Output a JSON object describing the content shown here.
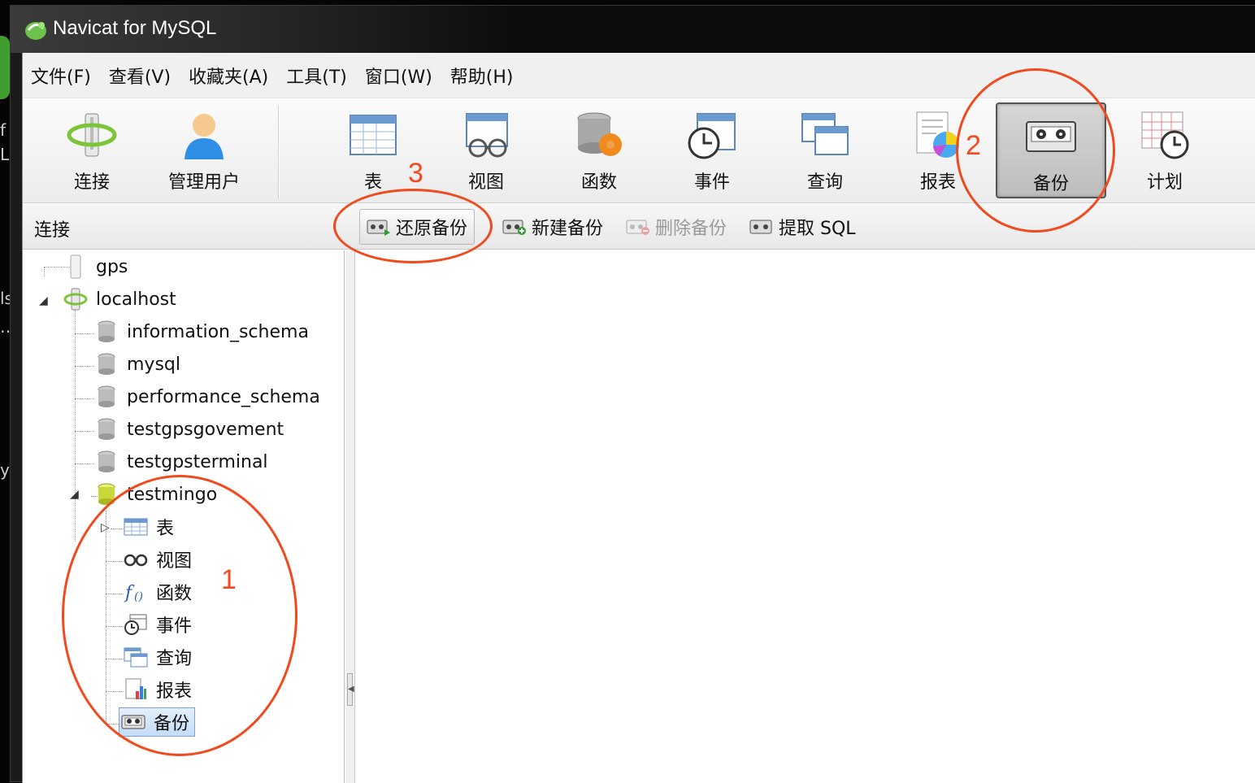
{
  "window": {
    "title": "Navicat for MySQL"
  },
  "desktop": {
    "sliver_texts": [
      "f",
      "L",
      "ls",
      "…",
      "yp"
    ]
  },
  "menu": [
    "文件(F)",
    "查看(V)",
    "收藏夹(A)",
    "工具(T)",
    "窗口(W)",
    "帮助(H)"
  ],
  "toolbar": {
    "connect": "连接",
    "manage_users": "管理用户",
    "table": "表",
    "view": "视图",
    "function": "函数",
    "event": "事件",
    "query": "查询",
    "report": "报表",
    "backup": "备份",
    "schedule": "计划"
  },
  "panel_header": {
    "connection": "连接"
  },
  "object_toolbar": {
    "restore": "还原备份",
    "new": "新建备份",
    "delete": "删除备份",
    "extract": "提取 SQL"
  },
  "tree": {
    "gps": "gps",
    "localhost": "localhost",
    "databases": [
      "information_schema",
      "mysql",
      "performance_schema",
      "testgpsgovement",
      "testgpsterminal"
    ],
    "open_db": "testmingo",
    "children": [
      "表",
      "视图",
      "函数",
      "事件",
      "查询",
      "报表",
      "备份"
    ]
  },
  "annotations": {
    "n1": "1",
    "n2": "2",
    "n3": "3",
    "color": "#f04a1e"
  },
  "colors": {
    "selection": "#c4dcf6",
    "active_button": "#bdbdbd"
  }
}
